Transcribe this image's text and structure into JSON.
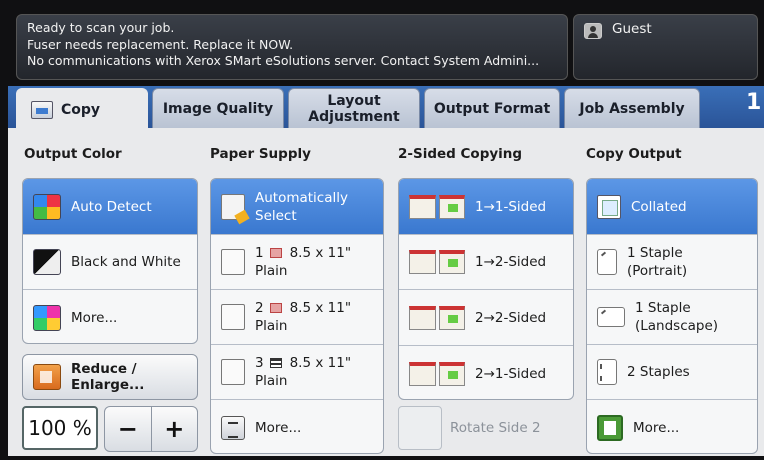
{
  "status": {
    "lines": [
      "Ready to scan your job.",
      "Fuser needs replacement.  Replace it NOW.",
      "No communications with Xerox SMart eSolutions server. Contact System Admini..."
    ],
    "user": "Guest",
    "user_icon": "person-card-icon"
  },
  "tabs": [
    {
      "label": "Copy",
      "icon": "copy-icon"
    },
    {
      "label": "Image Quality"
    },
    {
      "label": "Layout\nAdjustment"
    },
    {
      "label": "Output Format"
    },
    {
      "label": "Job Assembly"
    }
  ],
  "tab_overflow": "1",
  "output_color": {
    "header": "Output Color",
    "items": [
      {
        "label": "Auto Detect",
        "selected": true,
        "icon": "color-auto-icon"
      },
      {
        "label": "Black and White",
        "icon": "black-white-icon"
      },
      {
        "label": "More...",
        "icon": "color-more-icon"
      }
    ]
  },
  "reduce": {
    "label": "Reduce / Enlarge...",
    "icon": "reduce-enlarge-icon",
    "zoom": "100 %",
    "minus": "−",
    "plus": "+"
  },
  "paper_supply": {
    "header": "Paper Supply",
    "items": [
      {
        "line1": "Automatically",
        "line2": "Select",
        "selected": true
      },
      {
        "tray": "1",
        "size": "8.5 x 11\"",
        "type": "Plain"
      },
      {
        "tray": "2",
        "size": "8.5 x 11\"",
        "type": "Plain"
      },
      {
        "tray": "3",
        "size": "8.5 x 11\"",
        "type": "Plain"
      },
      {
        "label": "More..."
      }
    ]
  },
  "two_sided": {
    "header": "2-Sided Copying",
    "items": [
      {
        "label": "1→1-Sided",
        "selected": true
      },
      {
        "label": "1→2-Sided"
      },
      {
        "label": "2→2-Sided"
      },
      {
        "label": "2→1-Sided"
      }
    ],
    "rotate": "Rotate Side 2"
  },
  "copy_output": {
    "header": "Copy Output",
    "items": [
      {
        "line1": "Collated",
        "selected": true
      },
      {
        "line1": "1 Staple",
        "line2": "(Portrait)"
      },
      {
        "line1": "1 Staple",
        "line2": "(Landscape)"
      },
      {
        "line1": "2 Staples"
      },
      {
        "line1": "More..."
      }
    ]
  },
  "colors": {
    "accent": "#3a78cf",
    "tab_bar": "#2a5498"
  }
}
